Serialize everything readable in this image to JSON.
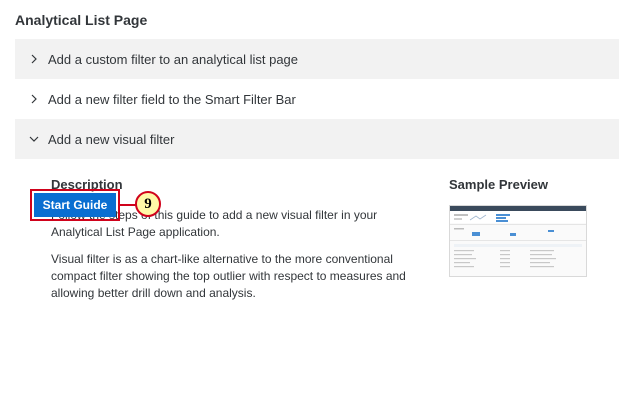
{
  "page": {
    "section_title": "Analytical List Page"
  },
  "accordion": {
    "items": [
      {
        "label": "Add a custom filter to an analytical list page",
        "expanded": false
      },
      {
        "label": "Add a new filter field to the Smart Filter Bar",
        "expanded": false
      },
      {
        "label": "Add a new visual filter",
        "expanded": true
      }
    ]
  },
  "panel": {
    "description_heading": "Description",
    "description_p1": "Follow the steps of this guide to add a new visual filter in your Analytical List Page application.",
    "description_p2": "Visual filter is as a chart-like alternative to the more conventional compact filter showing the top outlier with respect to measures and allowing better drill down and analysis.",
    "preview_heading": "Sample Preview",
    "start_button": "Start Guide",
    "step_marker": "9"
  },
  "colors": {
    "button_blue": "#0a6ed1",
    "highlight_red": "#d0021b",
    "marker_yellow": "#fff9a8",
    "row_shade": "#f2f2f2"
  },
  "icons": {
    "collapsed": "chevron-right-icon",
    "expanded": "chevron-down-icon"
  }
}
